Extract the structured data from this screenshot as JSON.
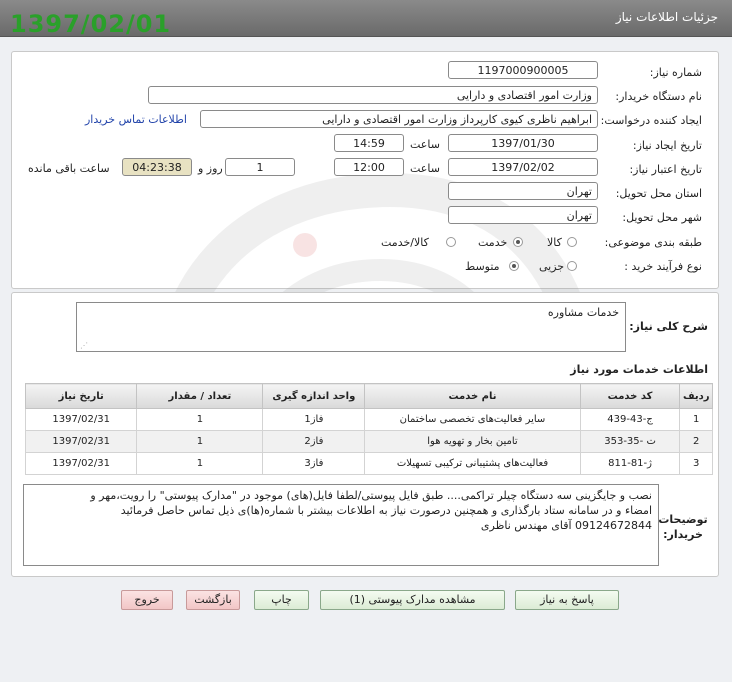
{
  "header": {
    "title": "جزئیات اطلاعات نیاز",
    "date_stamp": "1397/02/01"
  },
  "need": {
    "need_number_label": "شماره نیاز:",
    "need_number": "1197000900005",
    "buyer_org_label": "نام دستگاه خریدار:",
    "buyer_org": "وزارت امور اقتصادی و دارایی",
    "requester_label": "ایجاد کننده درخواست:",
    "requester": "ابراهیم  ناظری کیوی کارپرداز وزارت امور اقتصادی و دارایی",
    "contact_link": "اطلاعات تماس خریدار",
    "created_label": "تاریخ ایجاد نیاز:",
    "created_date": "1397/01/30",
    "time_label": "ساعت",
    "created_time": "14:59",
    "validity_label": "تاریخ اعتبار نیاز:",
    "validity_date": "1397/02/02",
    "validity_time": "12:00",
    "days_value": "1",
    "days_label": "روز و",
    "remaining_time": "04:23:38",
    "remaining_label": "ساعت باقی مانده",
    "province_label": "استان محل تحویل:",
    "province": "تهران",
    "city_label": "شهر محل تحویل:",
    "city": "تهران",
    "category_label": "طبقه بندی موضوعی:",
    "category_options": [
      "کالا",
      "خدمت",
      "کالا/خدمت"
    ],
    "category_selected": "خدمت",
    "process_label": "نوع فرآیند خرید :",
    "process_options": [
      "جزیی",
      "متوسط"
    ],
    "process_selected": "متوسط"
  },
  "summary": {
    "label": "شرح کلی نیاز:",
    "text": "خدمات مشاوره"
  },
  "services": {
    "section_title": "اطلاعات خدمات مورد نیاز",
    "columns": [
      "ردیف",
      "کد خدمت",
      "نام خدمت",
      "واحد اندازه گیری",
      "تعداد / مقدار",
      "تاریخ نیاز"
    ],
    "rows": [
      {
        "row": "1",
        "code": "ج-43-439",
        "name": "سایر فعالیت‌های تخصصی ساختمان",
        "unit": "فاز1",
        "qty": "1",
        "date": "1397/02/31"
      },
      {
        "row": "2",
        "code": "ت -35-353",
        "name": "تامین بخار و تهویه هوا",
        "unit": "فاز2",
        "qty": "1",
        "date": "1397/02/31"
      },
      {
        "row": "3",
        "code": "ژ-81-811",
        "name": "فعالیت‌های پشتیبانی ترکیبی تسهیلات",
        "unit": "فاز3",
        "qty": "1",
        "date": "1397/02/31"
      }
    ]
  },
  "notes": {
    "label": "توضیحات خریدار:",
    "line1": "نصب و جایگزینی سه دستگاه چیلر تراکمی.... طبق فایل پیوستی/لطفا فایل(های) موجود در \"مدارک پیوستی\" را رویت،مهر و",
    "line2": "امضاء و در سامانه ستاد بارگذاری و همچنین درصورت نیاز به اطلاعات بیشتر با شماره(ها)ی ذیل تماس حاصل فرمائید",
    "line3": "09124672844 آقای مهندس ناظری"
  },
  "buttons": {
    "respond": "پاسخ به نیاز",
    "attachments": "مشاهده مدارک پیوستی (1)",
    "print": "چاپ",
    "back": "بازگشت",
    "exit": "خروج"
  },
  "colors": {
    "date_stamp": "#2aa02a",
    "header_bg": "#7a7a7a",
    "highlight": "#e8e2c2",
    "link": "#2244aa"
  }
}
